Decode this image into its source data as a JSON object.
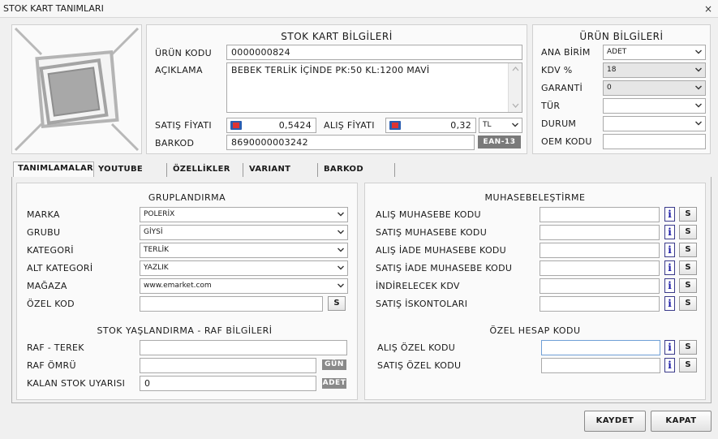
{
  "window": {
    "title": "STOK KART TANIMLARI",
    "close": "×"
  },
  "stok": {
    "header": "STOK KART BİLGİLERİ",
    "urun_kodu_label": "ÜRÜN KODU",
    "urun_kodu": "0000000824",
    "aciklama_label": "AÇIKLAMA",
    "aciklama": "BEBEK TERLİK İÇİNDE PK:50 KL:1200 MAVİ",
    "satis_label": "SATIŞ FİYATI",
    "satis": "0,5424",
    "alis_label": "ALIŞ FİYATI",
    "alis": "0,32",
    "currency": "TL",
    "barkod_label": "BARKOD",
    "barkod": "8690000003242",
    "barkod_type": "EAN-13"
  },
  "urun": {
    "header": "ÜRÜN BİLGİLERİ",
    "ana_birim_label": "ANA BİRİM",
    "ana_birim": "ADET",
    "kdv_label": "KDV %",
    "kdv": "18",
    "garanti_label": "GARANTİ",
    "garanti": "0",
    "tur_label": "TÜR",
    "tur": "",
    "durum_label": "DURUM",
    "durum": "",
    "oem_label": "OEM KODU",
    "oem": ""
  },
  "tabs": [
    "TANIMLAMALAR",
    "YOUTUBE",
    "ÖZELLİKLER",
    "VARIANT",
    "BARKOD"
  ],
  "grup": {
    "header": "GRUPLANDIRMA",
    "marka_label": "MARKA",
    "marka": "POLERİX",
    "grubu_label": "GRUBU",
    "grubu": "GİYSİ",
    "kategori_label": "KATEGORİ",
    "kategori": "TERLİK",
    "alt_kategori_label": "ALT KATEGORİ",
    "alt_kategori": "YAZLIK",
    "magaza_label": "MAĞAZA",
    "magaza": "www.emarket.com",
    "ozel_kod_label": "ÖZEL KOD",
    "ozel_kod": "",
    "s": "S"
  },
  "raf": {
    "header": "STOK YAŞLANDIRMA - RAF BİLGİLERİ",
    "terek_label": "RAF - TEREK",
    "terek": "",
    "omru_label": "RAF ÖMRÜ",
    "omru": "",
    "gun": "GÜN",
    "uyari_label": "KALAN STOK UYARISI",
    "uyari": "0",
    "adet": "ADET"
  },
  "muhasebe": {
    "header": "MUHASEBELEŞTİRME",
    "rows": [
      {
        "label": "ALIŞ MUHASEBE KODU",
        "value": ""
      },
      {
        "label": "SATIŞ MUHASEBE KODU",
        "value": ""
      },
      {
        "label": "ALIŞ İADE MUHASEBE KODU",
        "value": ""
      },
      {
        "label": "SATIŞ İADE MUHASEBE KODU",
        "value": ""
      },
      {
        "label": "İNDİRELECEK KDV",
        "value": ""
      },
      {
        "label": "SATIŞ İSKONTOLARI",
        "value": ""
      }
    ],
    "i": "i",
    "s": "S"
  },
  "ozel_hesap": {
    "header": "ÖZEL HESAP KODU",
    "rows": [
      {
        "label": "ALIŞ ÖZEL KODU",
        "value": ""
      },
      {
        "label": "SATIŞ ÖZEL KODU",
        "value": ""
      }
    ]
  },
  "buttons": {
    "kaydet": "KAYDET",
    "kapat": "KAPAT"
  }
}
